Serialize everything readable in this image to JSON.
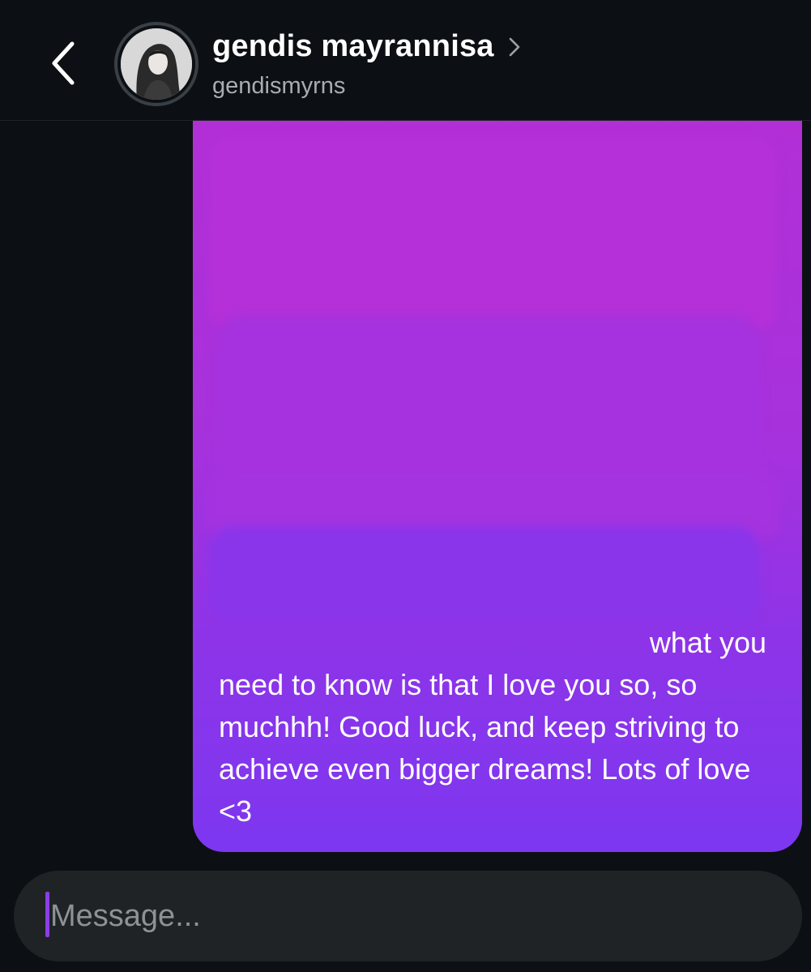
{
  "header": {
    "display_name": "gendis mayrannisa",
    "username": "gendismyrns",
    "back_icon": "chevron-left-icon",
    "profile_chevron_icon": "chevron-right-icon"
  },
  "message": {
    "line_1": "what you",
    "body": "need to know is that I love you so, so muchhh! Good luck, and keep striving to achieve even bigger dreams! Lots of love <3",
    "redacted": true
  },
  "composer": {
    "placeholder": "Message..."
  },
  "colors": {
    "background": "#0c1014",
    "bubble_top": "#b22fd6",
    "bubble_bottom": "#7d37f0",
    "composer_bg": "#1f2326",
    "caret": "#8b3ee8",
    "username_text": "#a8adb3"
  }
}
